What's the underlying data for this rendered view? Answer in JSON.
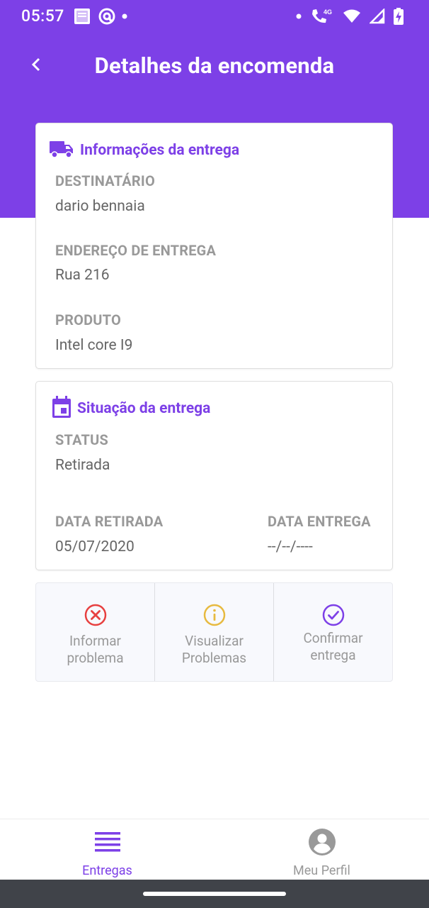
{
  "status_bar": {
    "time": "05:57",
    "network": "4G"
  },
  "header": {
    "title": "Detalhes da encomenda"
  },
  "delivery_info": {
    "title": "Informações da entrega",
    "recipient_label": "DESTINATÁRIO",
    "recipient_value": "dario bennaia",
    "address_label": "ENDEREÇO DE ENTREGA",
    "address_value": "Rua 216",
    "product_label": "PRODUTO",
    "product_value": "Intel core I9"
  },
  "delivery_status": {
    "title": "Situação da entrega",
    "status_label": "STATUS",
    "status_value": "Retirada",
    "pickup_date_label": "DATA RETIRADA",
    "pickup_date_value": "05/07/2020",
    "delivery_date_label": "DATA ENTREGA",
    "delivery_date_value": "--/--/----"
  },
  "actions": [
    {
      "label": "Informar\nproblema",
      "icon": "x-circle-icon",
      "color": "#e74040"
    },
    {
      "label": "Visualizar\nProblemas",
      "icon": "info-circle-icon",
      "color": "#e7ba40"
    },
    {
      "label": "Confirmar\nentrega",
      "icon": "check-circle-icon",
      "color": "#7d40e7"
    }
  ],
  "bottom_nav": {
    "items": [
      {
        "label": "Entregas",
        "icon": "list-icon",
        "active": true
      },
      {
        "label": "Meu Perfil",
        "icon": "account-circle-icon",
        "active": false
      }
    ]
  },
  "colors": {
    "primary": "#7d40e7",
    "danger": "#e74040",
    "warning": "#e7ba40"
  }
}
